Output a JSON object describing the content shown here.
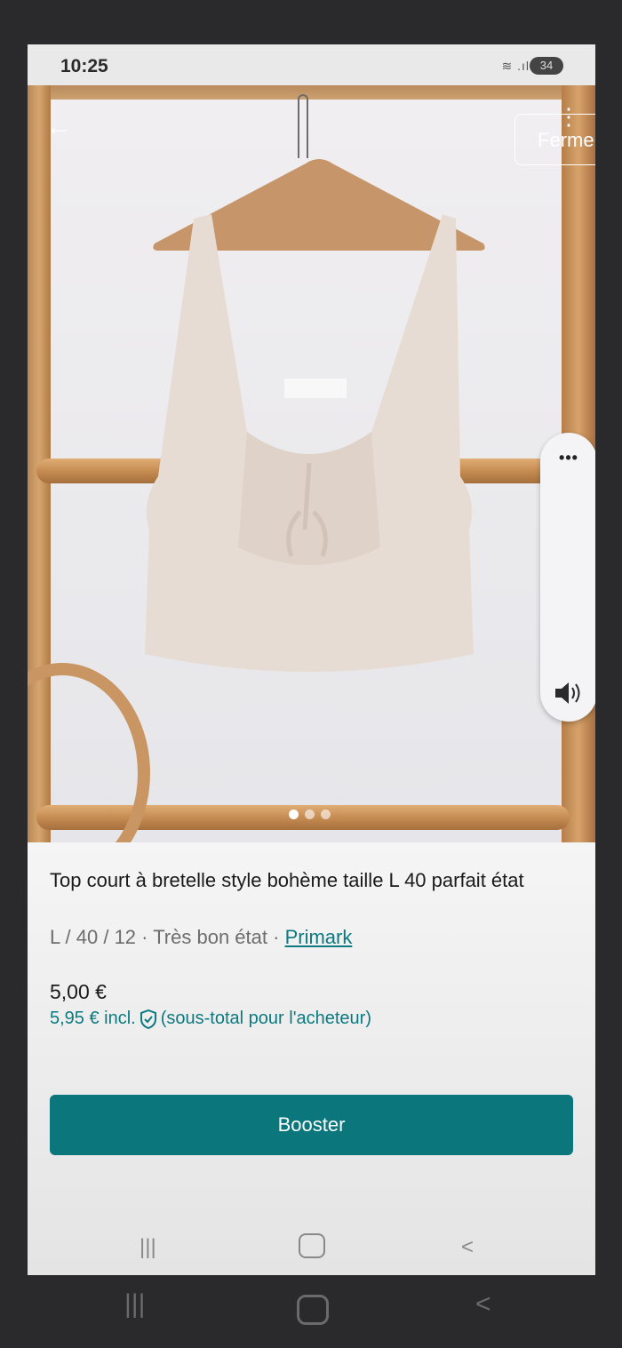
{
  "status_bar": {
    "time": "10:25",
    "signal": "≋ .ıl",
    "battery": "34"
  },
  "overlay": {
    "close_label": "Fermer",
    "more_label": "⋮",
    "back_label": "←",
    "volume_more": "•••"
  },
  "listing": {
    "title": "Top court à bretelle style bohème taille L 40 parfait état",
    "size_condition": "L / 40 / 12 · Très bon état · ",
    "brand": "Primark",
    "price": "5,00 €",
    "price_incl_amount": "5,95 €  incl.",
    "price_incl_note": "(sous-total pour l'acheteur)",
    "photo_index": 1,
    "photo_count": 3
  },
  "actions": {
    "booster_label": "Booster"
  },
  "colors": {
    "accent": "#0b777c",
    "link": "#0b7a80"
  },
  "icons": [
    "back-arrow-icon",
    "more-vert-icon",
    "speaker-icon",
    "shield-check-icon",
    "recent-apps-icon",
    "home-icon",
    "nav-back-icon"
  ]
}
